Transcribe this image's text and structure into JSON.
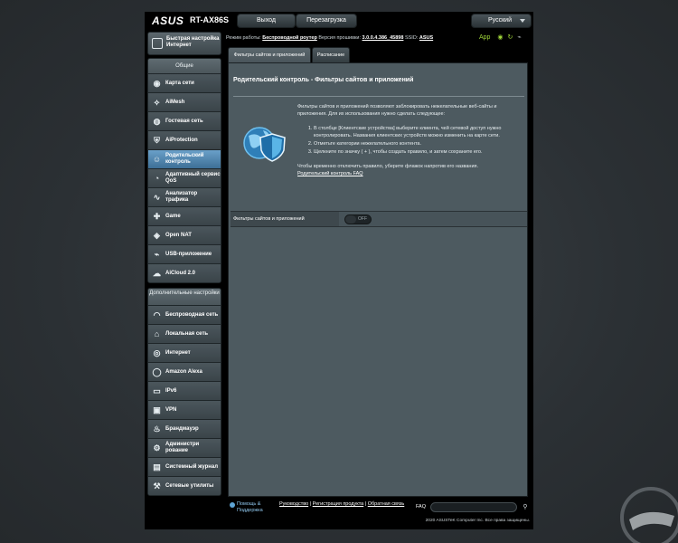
{
  "header": {
    "logo": "ASUS",
    "model": "RT-AX86S",
    "logout_label": "Выход",
    "reboot_label": "Перезагрузка",
    "language": "Русский"
  },
  "status": {
    "mode_label": "Режим работы:",
    "mode_value": "Беспроводной роутер",
    "firmware_label": "Версия прошивки:",
    "firmware_value": "3.0.0.4.386_45898",
    "ssid_label": "SSID:",
    "ssid_value": "ASUS",
    "app_label": "App"
  },
  "sidebar": {
    "quick_setup": "Быстрая настройка Интернет",
    "general_header": "Общие",
    "general_items": [
      {
        "label": "Карта сети",
        "icon": "network-map-icon"
      },
      {
        "label": "AiMesh",
        "icon": "aimesh-icon"
      },
      {
        "label": "Гостевая сеть",
        "icon": "guest-network-icon"
      },
      {
        "label": "AiProtection",
        "icon": "aiprotection-icon"
      },
      {
        "label": "Родительский контроль",
        "icon": "parental-control-icon"
      },
      {
        "label": "Адаптивный сервис QoS",
        "icon": "qos-icon"
      },
      {
        "label": "Анализатор трафика",
        "icon": "traffic-analyzer-icon"
      },
      {
        "label": "Game",
        "icon": "gamepad-icon"
      },
      {
        "label": "Open NAT",
        "icon": "open-nat-icon"
      },
      {
        "label": "USB-приложение",
        "icon": "usb-icon"
      },
      {
        "label": "AiCloud 2.0",
        "icon": "cloud-icon"
      }
    ],
    "advanced_header": "Дополнительные настройки",
    "advanced_items": [
      {
        "label": "Беспроводная сеть",
        "icon": "wireless-icon"
      },
      {
        "label": "Локальная сеть",
        "icon": "lan-icon"
      },
      {
        "label": "Интернет",
        "icon": "globe-icon"
      },
      {
        "label": "Amazon Alexa",
        "icon": "alexa-icon"
      },
      {
        "label": "IPv6",
        "icon": "ipv6-icon"
      },
      {
        "label": "VPN",
        "icon": "vpn-icon"
      },
      {
        "label": "Брандмауэр",
        "icon": "firewall-icon"
      },
      {
        "label": "Администрирование",
        "icon": "admin-icon"
      },
      {
        "label": "Системный журнал",
        "icon": "log-icon"
      },
      {
        "label": "Сетевые утилиты",
        "icon": "tools-icon"
      }
    ]
  },
  "tabs": [
    {
      "label": "Фильтры сайтов и приложений"
    },
    {
      "label": "Расписание"
    }
  ],
  "main": {
    "title": "Родительский контроль - Фильтры сайтов и приложений",
    "intro": "Фильтры сайтов и приложений позволяют заблокировать нежелательные веб-сайты и приложения. Для их использования нужно сделать следующее:",
    "steps": [
      "В столбце [Клиентские устройства] выберите клиента, чей сетевой доступ нужно контролировать. Названия клиентских устройств можно изменить на карте сети.",
      "Отметьте категории нежелательного контента.",
      "Щелкните по значку ( + ), чтобы создать правило, и затем сохраните его."
    ],
    "note": "Чтобы временно отключить правило, уберите флажок напротив его названия.",
    "faq_link": "Родительский контроль FAQ",
    "setting_label": "Фильтры сайтов и приложений",
    "toggle_state": "OFF"
  },
  "footer": {
    "help": "Помощь & Поддержка",
    "manual": "Руководство",
    "register": "Регистрация продукта",
    "feedback": "Обратная связь",
    "faq": "FAQ",
    "copyright": "2020 ASUSTeK Computer Inc. Все права защищены."
  }
}
